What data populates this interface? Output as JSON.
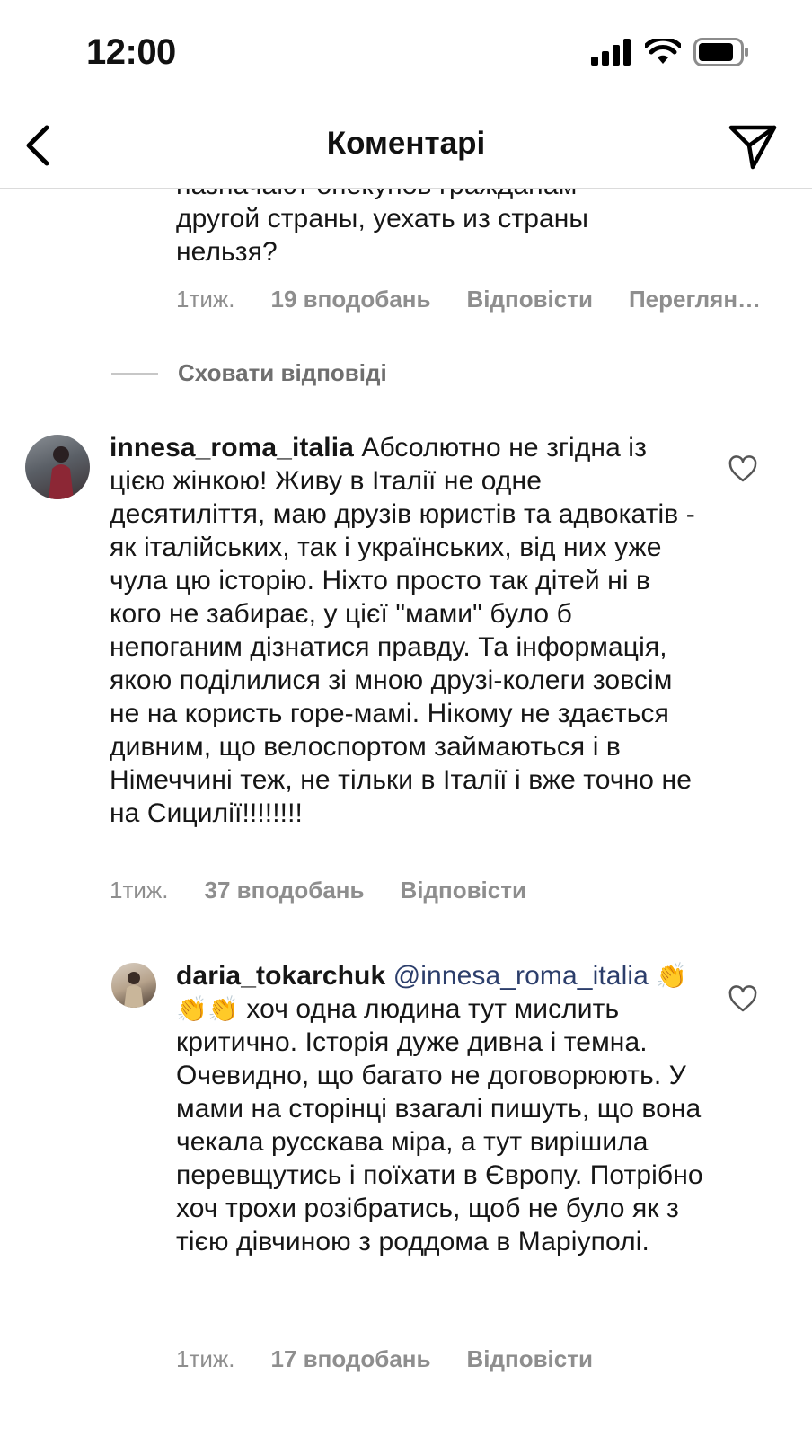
{
  "status_bar": {
    "time": "12:00",
    "icons": [
      "signal-icon",
      "wifi-icon",
      "battery-icon"
    ]
  },
  "nav": {
    "title": "Коментарі",
    "back_icon": "chevron-left-icon",
    "share_icon": "paper-plane-icon"
  },
  "previous_comment": {
    "text_lines": [
      "назначают опекунов гражданам",
      "другой страны, уехать из страны",
      "нельзя?"
    ],
    "time": "1тиж.",
    "likes": "19 вподобань",
    "reply": "Відповісти",
    "view": "Переглянути переклад"
  },
  "hide_replies": "Сховати відповіді",
  "comments": [
    {
      "username": "innesa_roma_italia",
      "text": "Абсолютно не згідна із цією жінкою! Живу в Італії не одне десятиліття, маю друзів юристів та адвокатів - як італійських, так і українських, від них уже чула цю історію. Ніхто просто так дітей ні в кого не забирає, у цієї \"мами\" було б непоганим дізнатися правду. Та інформація, якою поділилися зі мною друзі-колеги зовсім не на користь горе-мамі. Нікому не здається дивним, що велоспортом займаються і в Німеччині теж, не тільки в Італії і вже точно не на Сицилії!!!!!!!!",
      "time": "1тиж.",
      "likes": "37 вподобань",
      "reply": "Відповісти"
    },
    {
      "username": "daria_tokarchuk",
      "mention": "@innesa_roma_italia",
      "emoji": "👏👏👏",
      "text": "хоч одна людина тут мислить критично. Історія дуже дивна і темна. Очевидно, що багато не договорюють. У мами на сторінці взагалі пишуть, що вона чекала русскава міра, а тут вирішила перевщутись і поїхати в Європу. Потрібно хоч трохи розібратись, щоб не було як з тією дівчиною з роддома в Маріуполі.",
      "time": "1тиж.",
      "likes": "17 вподобань",
      "reply": "Відповісти"
    }
  ]
}
